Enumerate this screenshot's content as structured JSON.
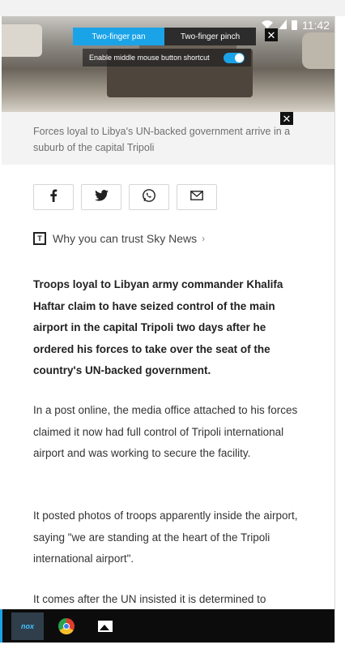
{
  "status": {
    "time": "11:42"
  },
  "overlay": {
    "two_finger_pan": "Two-finger pan",
    "two_finger_pinch": "Two-finger pinch",
    "shortcut_label": "Enable middle mouse button shortcut",
    "shortcut_enabled": true
  },
  "article": {
    "caption": "Forces loyal to Libya's UN-backed government arrive in a suburb of the capital Tripoli",
    "share": [
      "facebook-icon",
      "twitter-icon",
      "whatsapp-icon",
      "email-icon"
    ],
    "trust_text": "Why you can trust Sky News",
    "trust_icon_letter": "T",
    "lead": "Troops loyal to Libyan army commander Khalifa Haftar claim to have seized control of the main airport in the capital Tripoli two days after he ordered his forces to take over the seat of the country's UN-backed government.",
    "paragraphs": [
      "In a post online, the media office attached to his forces claimed it now had full control of Tripoli international airport and was working to secure the facility.",
      "It posted photos of troops apparently inside the airport, saying \"we are standing at the heart of the Tripoli international airport\".",
      "It comes after the UN insisted it is determined to"
    ]
  },
  "taskbar": {
    "nox_label": "nox"
  },
  "colors": {
    "accent": "#1ba3e8",
    "taskbar": "#0c0c0c"
  }
}
